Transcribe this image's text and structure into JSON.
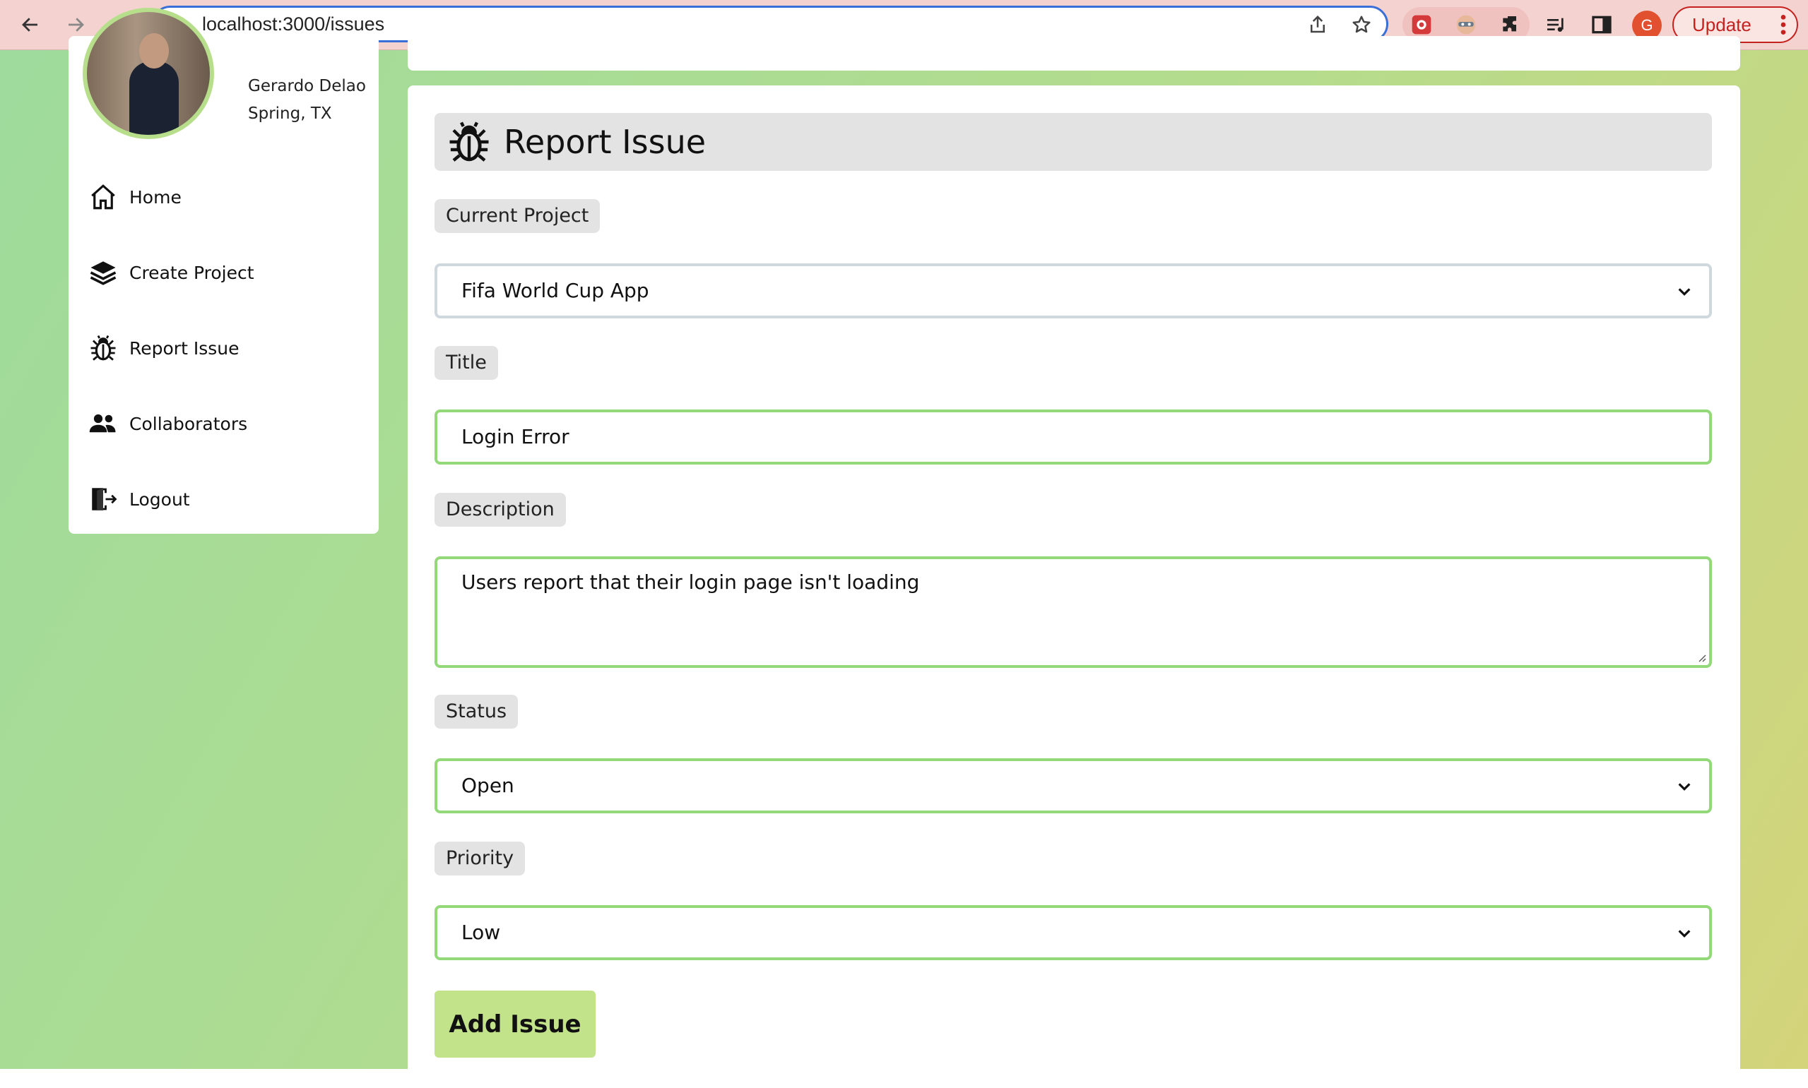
{
  "browser": {
    "url": "localhost:3000/issues",
    "profile_initial": "G",
    "update_label": "Update",
    "colors": {
      "chrome_bg": "#f4d2cf",
      "focus_ring": "#3a6fd8",
      "update_red": "#c5221f"
    }
  },
  "profile": {
    "name": "Gerardo Delao",
    "location": "Spring, TX"
  },
  "sidebar": {
    "items": [
      {
        "label": "Home",
        "icon": "home-icon"
      },
      {
        "label": "Create Project",
        "icon": "layers-icon"
      },
      {
        "label": "Report Issue",
        "icon": "bug-icon"
      },
      {
        "label": "Collaborators",
        "icon": "people-icon"
      },
      {
        "label": "Logout",
        "icon": "logout-icon"
      }
    ]
  },
  "form": {
    "heading": "Report Issue",
    "heading_icon": "bug-icon",
    "project_label": "Current Project",
    "project_value": "Fifa World Cup App",
    "title_label": "Title",
    "title_value": "Login Error",
    "description_label": "Description",
    "description_value": "Users report that their login page isn't loading",
    "status_label": "Status",
    "status_value": "Open",
    "priority_label": "Priority",
    "priority_value": "Low",
    "submit_label": "Add Issue",
    "colors": {
      "field_border": "#93d97a",
      "button_bg": "#c3e38a",
      "chip_bg": "#e3e3e3"
    }
  }
}
